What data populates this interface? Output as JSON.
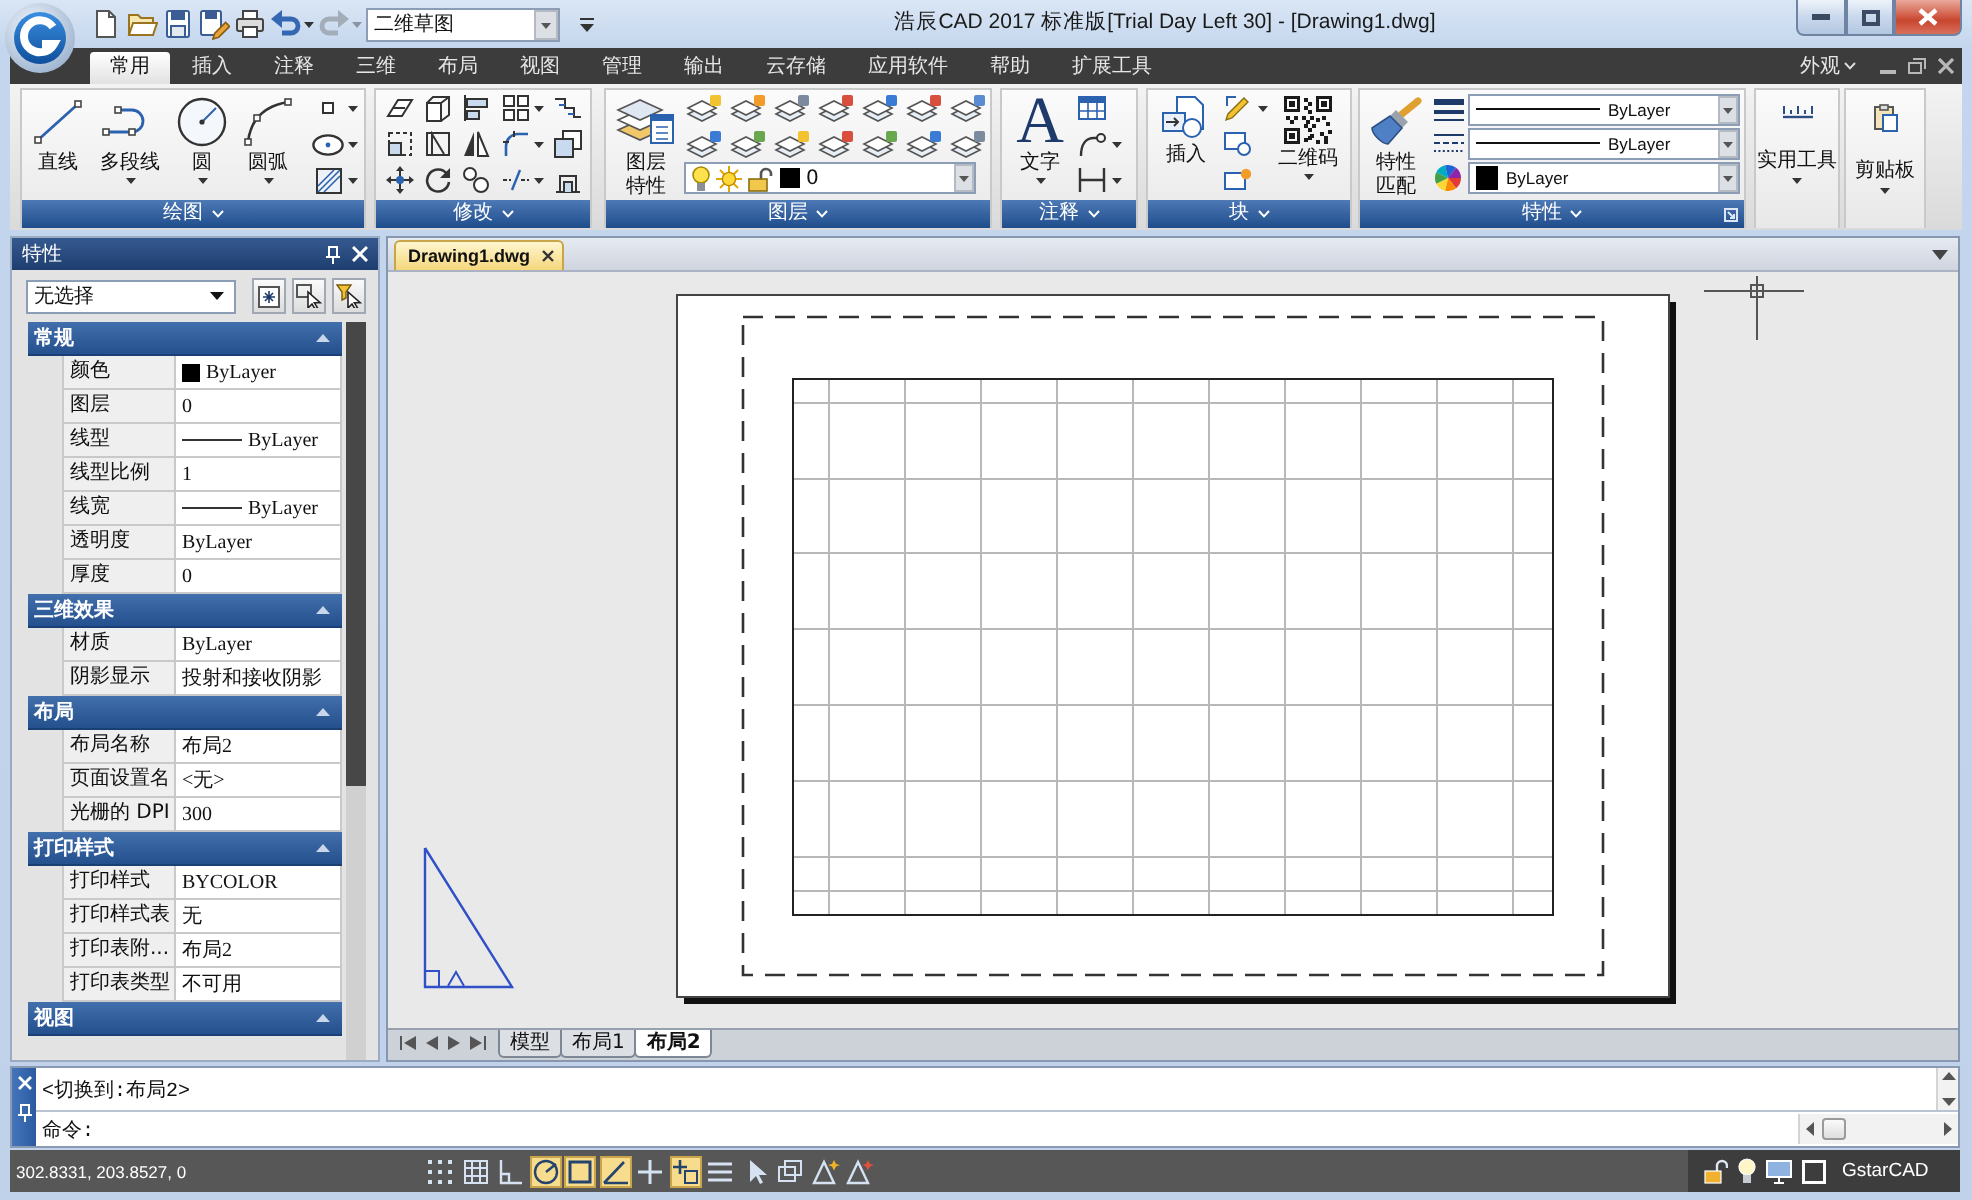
{
  "window": {
    "title": "浩辰CAD 2017 标准版[Trial Day Left 30] - [Drawing1.dwg]"
  },
  "quick_access": {
    "tools": [
      {
        "dropdown": false,
        "disabled": false
      },
      {
        "dropdown": false,
        "disabled": false
      },
      {
        "dropdown": false,
        "disabled": false
      },
      {
        "dropdown": false,
        "disabled": false
      },
      {
        "dropdown": false,
        "disabled": false
      },
      {
        "dropdown": true,
        "disabled": false
      },
      {
        "dropdown": true,
        "disabled": true
      }
    ],
    "workspace": "二维草图"
  },
  "ribbon": {
    "tabs": [
      {
        "label": "常用",
        "selected": true
      },
      {
        "label": "插入",
        "selected": false
      },
      {
        "label": "注释",
        "selected": false
      },
      {
        "label": "三维",
        "selected": false
      },
      {
        "label": "布局",
        "selected": false
      },
      {
        "label": "视图",
        "selected": false
      },
      {
        "label": "管理",
        "selected": false
      },
      {
        "label": "输出",
        "selected": false
      },
      {
        "label": "云存储",
        "selected": false
      },
      {
        "label": "应用软件",
        "selected": false
      },
      {
        "label": "帮助",
        "selected": false
      },
      {
        "label": "扩展工具",
        "selected": false
      }
    ],
    "appearance": "外观",
    "groups": [
      {
        "kind": "panel",
        "title": "绘图",
        "launcher": false,
        "buttons": [
          {
            "label": "直线",
            "dropdown": false
          },
          {
            "label": "多段线",
            "dropdown": true
          },
          {
            "label": "圆",
            "dropdown": true
          },
          {
            "label": "圆弧",
            "dropdown": true
          }
        ],
        "tools": [
          {
            "dropdown": true
          },
          {
            "dropdown": true
          },
          {
            "dropdown": true
          }
        ]
      },
      {
        "kind": "panel",
        "title": "修改",
        "launcher": false,
        "tools": [
          {
            "dropdown": false
          },
          {
            "dropdown": false
          },
          {
            "dropdown": false
          },
          {
            "dropdown": true
          },
          {
            "dropdown": false
          },
          {
            "dropdown": false
          },
          {
            "dropdown": false
          },
          {
            "dropdown": false
          },
          {
            "dropdown": true
          },
          {
            "dropdown": false
          },
          {
            "dropdown": false
          },
          {
            "dropdown": false
          },
          {
            "dropdown": false
          },
          {
            "dropdown": true
          },
          {
            "dropdown": false
          }
        ]
      },
      {
        "kind": "panel",
        "title": "图层",
        "launcher": false,
        "buttons": [
          {
            "label": "图层特性",
            "dropdown": false
          }
        ],
        "layer": {
          "name": "0",
          "on": true,
          "frozen": false,
          "locked": false,
          "color": "#000000"
        }
      },
      {
        "kind": "panel",
        "title": "注释",
        "launcher": false,
        "buttons": [
          {
            "label": "文字",
            "glyph": "A",
            "dropdown": true
          }
        ],
        "tools": [
          {
            "dropdown": false
          },
          {
            "dropdown": true
          },
          {
            "dropdown": true
          }
        ]
      },
      {
        "kind": "panel",
        "title": "块",
        "launcher": false,
        "buttons": [
          {
            "label": "插入",
            "dropdown": false
          },
          {
            "label": "二维码",
            "dropdown": true
          }
        ],
        "tools": [
          {
            "dropdown": true
          },
          {
            "dropdown": false
          },
          {
            "dropdown": false
          }
        ]
      },
      {
        "kind": "panel",
        "title": "特性",
        "launcher": true,
        "buttons": [
          {
            "label": "特性匹配",
            "dropdown": false
          }
        ],
        "dropdowns": [
          {
            "kind": "line",
            "value": "ByLayer"
          },
          {
            "kind": "line",
            "value": "ByLayer"
          },
          {
            "kind": "swatch",
            "value": "ByLayer",
            "color": "#000000"
          }
        ]
      },
      {
        "kind": "collapsed",
        "title": "实用工具",
        "dropdown": true
      },
      {
        "kind": "collapsed",
        "title": "剪贴板",
        "dropdown": true
      }
    ]
  },
  "properties": {
    "title": "特性",
    "selection": "无选择",
    "sections": [
      {
        "title": "常规",
        "expanded": true,
        "rows": [
          {
            "name": "颜色",
            "kind": "swatch",
            "value": "ByLayer",
            "color": "#000000"
          },
          {
            "name": "图层",
            "kind": "text",
            "value": "0"
          },
          {
            "name": "线型",
            "kind": "line",
            "value": "ByLayer"
          },
          {
            "name": "线型比例",
            "kind": "text",
            "value": "1"
          },
          {
            "name": "线宽",
            "kind": "line",
            "value": "ByLayer"
          },
          {
            "name": "透明度",
            "kind": "text",
            "value": "ByLayer"
          },
          {
            "name": "厚度",
            "kind": "text",
            "value": "0"
          }
        ]
      },
      {
        "title": "三维效果",
        "expanded": true,
        "rows": [
          {
            "name": "材质",
            "kind": "text",
            "value": "ByLayer"
          },
          {
            "name": "阴影显示",
            "kind": "text",
            "value": "投射和接收阴影"
          }
        ]
      },
      {
        "title": "布局",
        "expanded": true,
        "rows": [
          {
            "name": "布局名称",
            "kind": "text",
            "value": "布局2"
          },
          {
            "name": "页面设置名",
            "kind": "text",
            "value": "<无>"
          },
          {
            "name": "光栅的 DPI",
            "kind": "text",
            "value": "300"
          }
        ]
      },
      {
        "title": "打印样式",
        "expanded": true,
        "rows": [
          {
            "name": "打印样式",
            "kind": "text",
            "value": "BYCOLOR"
          },
          {
            "name": "打印样式表",
            "kind": "text",
            "value": "无"
          },
          {
            "name": "打印表附...",
            "kind": "text",
            "value": "布局2"
          },
          {
            "name": "打印表类型",
            "kind": "text",
            "value": "不可用"
          }
        ]
      },
      {
        "title": "视图",
        "expanded": true
      }
    ]
  },
  "drawing": {
    "tabs": [
      {
        "label": "Drawing1.dwg",
        "selected": true
      }
    ],
    "layout_tabs": [
      {
        "label": "模型",
        "selected": false
      },
      {
        "label": "布局1",
        "selected": false
      },
      {
        "label": "布局2",
        "selected": true
      }
    ]
  },
  "command_line": {
    "history": [
      "<切换到:布局2>"
    ],
    "prompt": "命令:"
  },
  "status_bar": {
    "coordinates": "302.8331, 203.8527, 0",
    "toggles": [
      {
        "on": false
      },
      {
        "on": false
      },
      {
        "on": false
      },
      {
        "on": true
      },
      {
        "on": true
      },
      {
        "on": true
      },
      {
        "on": false
      },
      {
        "on": true
      },
      {
        "on": false
      },
      {
        "on": false
      },
      {
        "on": false
      },
      {
        "on": false
      },
      {
        "on": false
      }
    ],
    "brand": "GstarCAD"
  }
}
